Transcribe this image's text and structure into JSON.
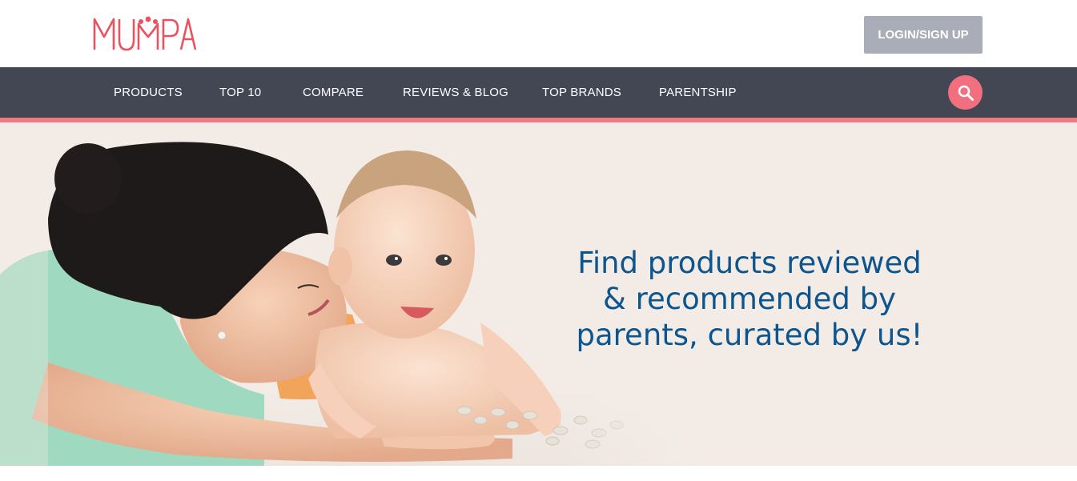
{
  "brand": {
    "name": "MUMPA",
    "logo_color": "#e8535f"
  },
  "header": {
    "login_label": "LOGIN/SIGN UP"
  },
  "nav": {
    "items": [
      {
        "label": "PRODUCTS"
      },
      {
        "label": "TOP 10"
      },
      {
        "label": "COMPARE"
      },
      {
        "label": "REVIEWS & BLOG"
      },
      {
        "label": "TOP BRANDS"
      },
      {
        "label": "PARENTSHIP"
      }
    ],
    "search_icon": "search-icon",
    "bar_color": "#424753",
    "accent_color": "#f07a80"
  },
  "hero": {
    "headline_lines": [
      "Find products reviewed",
      "& recommended by",
      "parents, curated by us!"
    ],
    "headline_color": "#0c558f",
    "background": "#f3ece6"
  }
}
